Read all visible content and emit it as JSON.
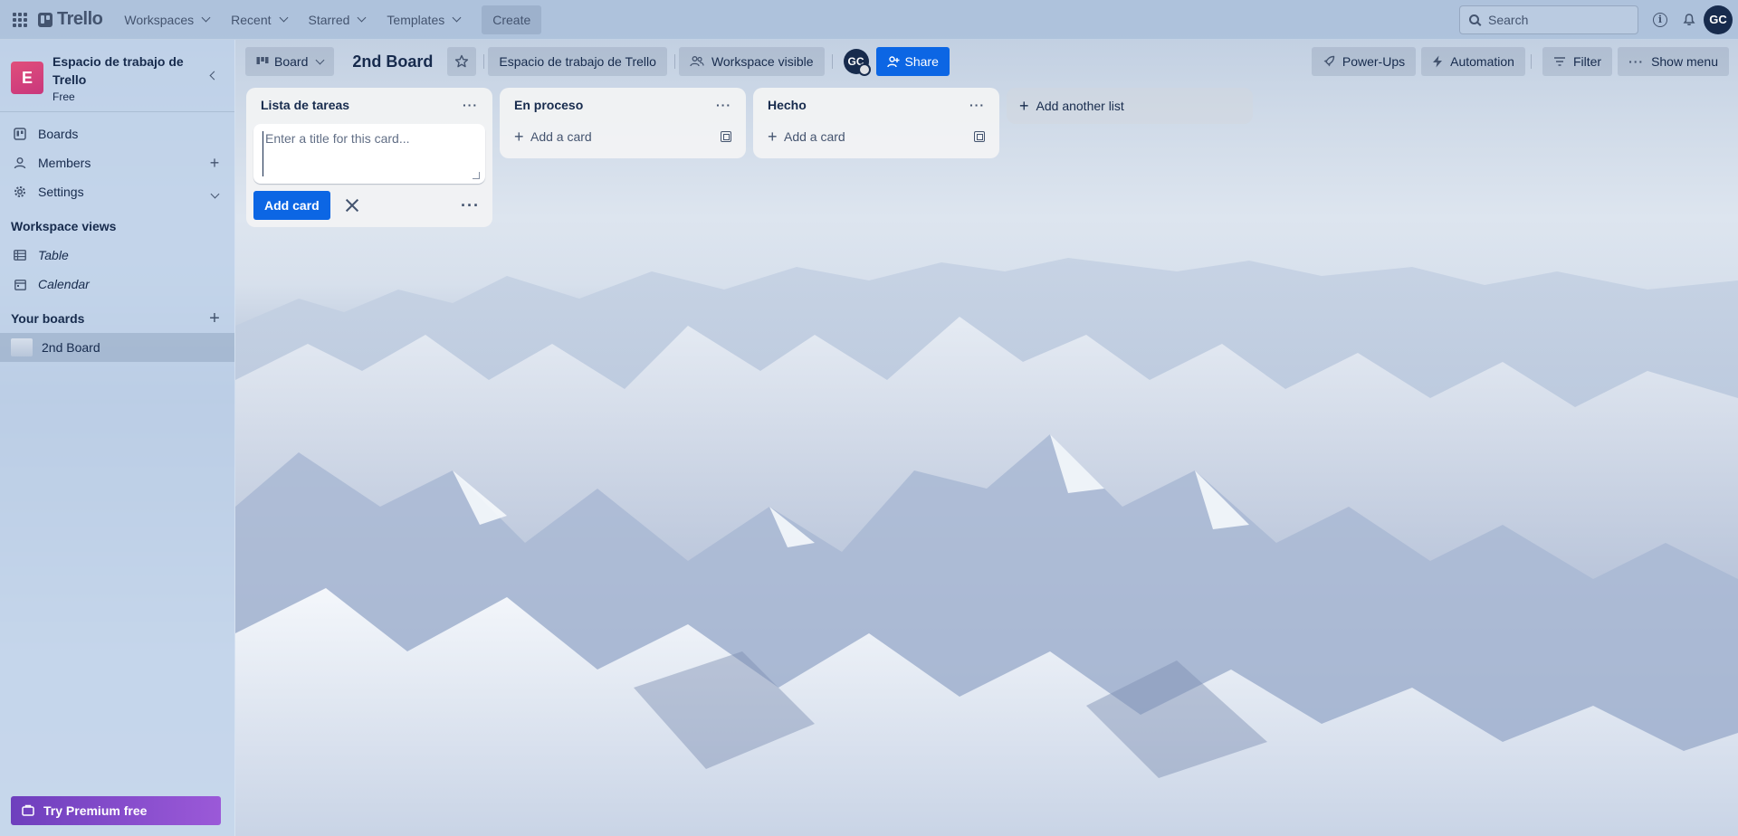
{
  "topnav": {
    "logo": "Trello",
    "menus": [
      {
        "label": "Workspaces"
      },
      {
        "label": "Recent"
      },
      {
        "label": "Starred"
      },
      {
        "label": "Templates"
      }
    ],
    "create_label": "Create",
    "search_placeholder": "Search",
    "avatar_initials": "GC"
  },
  "sidebar": {
    "workspace_letter": "E",
    "workspace_name": "Espacio de trabajo de Trello",
    "workspace_plan": "Free",
    "items": [
      {
        "label": "Boards",
        "icon": "trello-board-icon"
      },
      {
        "label": "Members",
        "icon": "person-icon"
      },
      {
        "label": "Settings",
        "icon": "gear-icon"
      }
    ],
    "views_heading": "Workspace views",
    "views": [
      {
        "label": "Table",
        "icon": "table-icon"
      },
      {
        "label": "Calendar",
        "icon": "calendar-icon"
      }
    ],
    "boards_heading": "Your boards",
    "boards": [
      {
        "label": "2nd Board"
      }
    ],
    "premium_label": "Try Premium free"
  },
  "board_header": {
    "view_label": "Board",
    "title": "2nd Board",
    "workspace_label": "Espacio de trabajo de Trello",
    "visibility_label": "Workspace visible",
    "member_initials": "GC",
    "share_label": "Share",
    "powerups_label": "Power-Ups",
    "automation_label": "Automation",
    "filter_label": "Filter",
    "show_menu_label": "Show menu"
  },
  "lists": [
    {
      "title": "Lista de tareas",
      "composer_placeholder": "Enter a title for this card...",
      "add_card_button": "Add card"
    },
    {
      "title": "En proceso",
      "add_card": "Add a card"
    },
    {
      "title": "Hecho",
      "add_card": "Add a card"
    }
  ],
  "add_list_label": "Add another list",
  "colors": {
    "accent": "#0c66e4",
    "premium": "#7f4fce",
    "workspace_logo": "#d9437b"
  }
}
